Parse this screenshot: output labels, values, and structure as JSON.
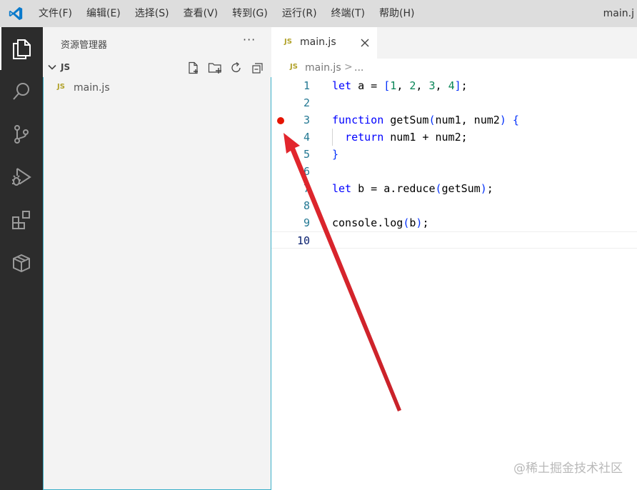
{
  "menu": {
    "items": [
      "文件(F)",
      "编辑(E)",
      "选择(S)",
      "查看(V)",
      "转到(G)",
      "运行(R)",
      "终端(T)",
      "帮助(H)"
    ],
    "window_title": "main.j"
  },
  "activity_bar": {
    "icons": [
      "explorer-icon",
      "search-icon",
      "source-control-icon",
      "run-debug-icon",
      "extensions-icon",
      "package-icon"
    ],
    "active": "explorer-icon"
  },
  "sidebar": {
    "title": "资源管理器",
    "more_label": "···",
    "folder": {
      "name": "JS",
      "expanded": true
    },
    "folder_actions": [
      "new-file-icon",
      "new-folder-icon",
      "refresh-icon",
      "collapse-all-icon"
    ],
    "files": [
      {
        "badge": "JS",
        "name": "main.js"
      }
    ]
  },
  "editor": {
    "tab": {
      "badge": "JS",
      "label": "main.js"
    },
    "breadcrumb": {
      "badge": "JS",
      "file": "main.js",
      "separator": ">",
      "more": "..."
    },
    "lines": [
      {
        "no": "1",
        "text": "let a = [1, 2, 3, 4];"
      },
      {
        "no": "2",
        "text": ""
      },
      {
        "no": "3",
        "text": "function getSum(num1, num2) {",
        "breakpoint": true
      },
      {
        "no": "4",
        "text": "  return num1 + num2;"
      },
      {
        "no": "5",
        "text": "}"
      },
      {
        "no": "6",
        "text": ""
      },
      {
        "no": "7",
        "text": "let b = a.reduce(getSum);"
      },
      {
        "no": "8",
        "text": ""
      },
      {
        "no": "9",
        "text": "console.log(b);"
      },
      {
        "no": "10",
        "text": "",
        "current": true
      }
    ],
    "breakpoint_color": "#e51400"
  },
  "annotation": {
    "arrow_color": "#e3262d"
  },
  "watermark": "@稀土掘金技术社区",
  "colors": {
    "accent": "#007acc",
    "activity_bar": "#2c2c2c",
    "sidebar": "#f3f3f3",
    "titlebar": "#dddddd"
  }
}
